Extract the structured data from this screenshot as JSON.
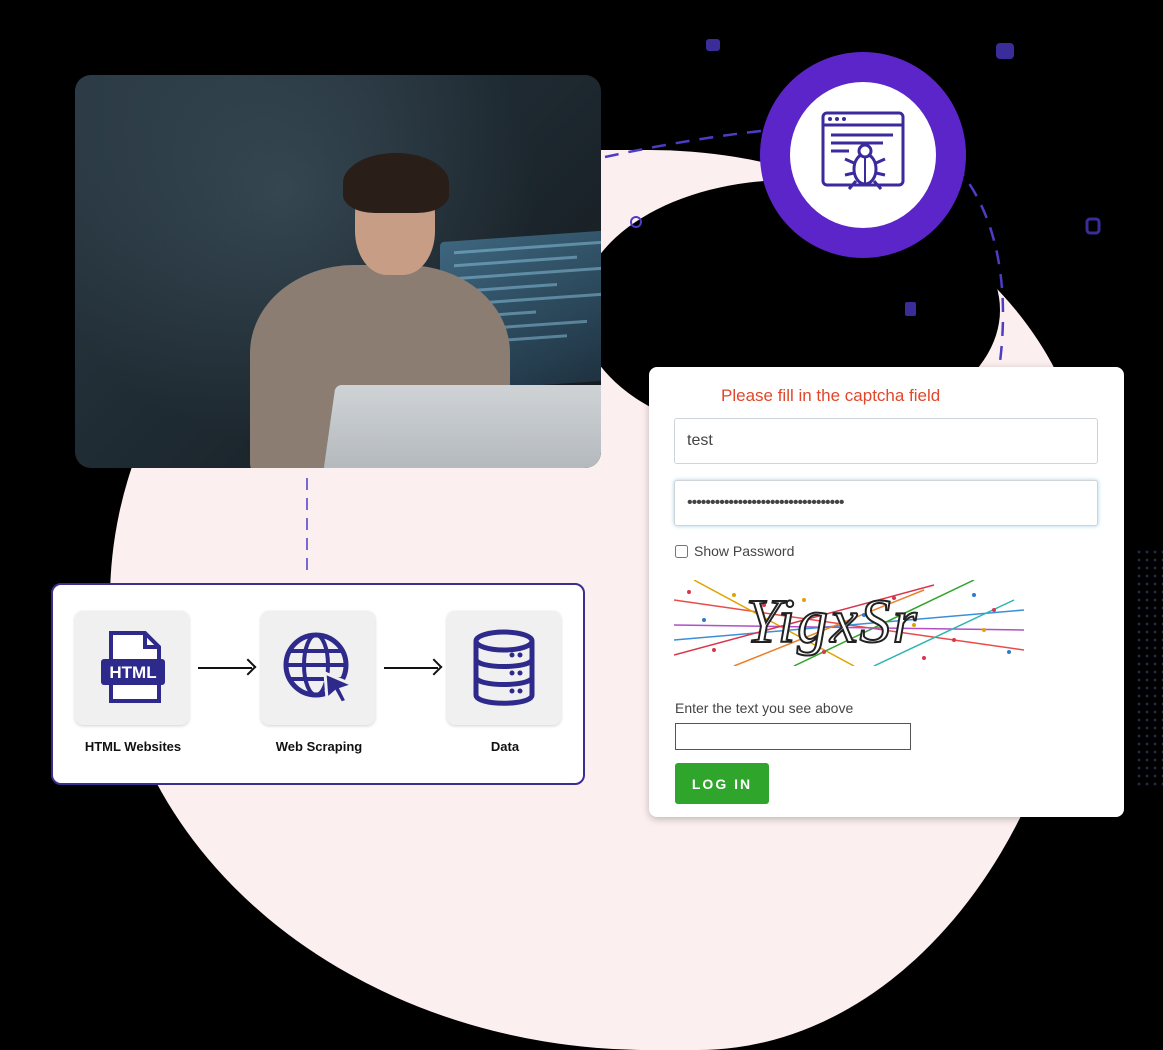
{
  "illustration": {
    "photo_alt": "Developer typing on laptop with code display",
    "bug_icon": "web-bug-icon"
  },
  "flow": {
    "steps": [
      {
        "label": "HTML Websites",
        "icon": "html-file-icon"
      },
      {
        "label": "Web Scraping",
        "icon": "globe-cursor-icon"
      },
      {
        "label": "Data",
        "icon": "database-icon"
      }
    ]
  },
  "login": {
    "error_message": "Please fill in the captcha field",
    "username_value": "test",
    "password_value": "••••••••••••••••••••••••••••••••••",
    "show_password_label": "Show Password",
    "captcha_text": "YigxSr",
    "captcha_hint": "Enter the text you see above",
    "captcha_value": "",
    "login_button_label": "LOG IN"
  },
  "colors": {
    "accent_purple": "#5b25c9",
    "error_red": "#e0472b",
    "login_green": "#2fa52b",
    "flow_border": "#3b2e8f",
    "icon_navy": "#2e2a8c"
  }
}
